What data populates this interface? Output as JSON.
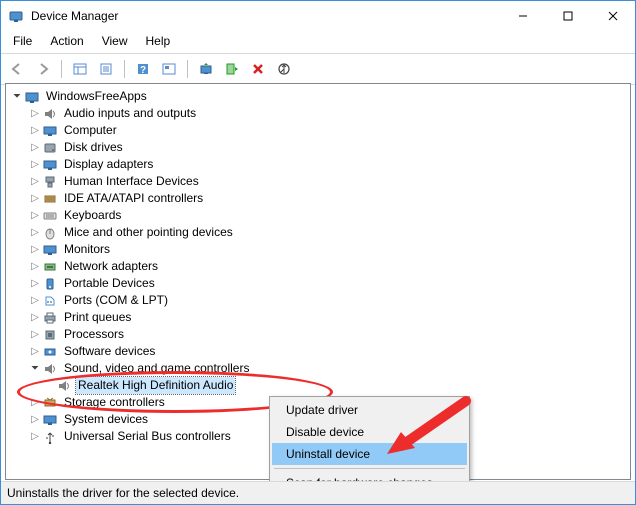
{
  "window": {
    "title": "Device Manager"
  },
  "menus": {
    "file": "File",
    "action": "Action",
    "view": "View",
    "help": "Help"
  },
  "tree": {
    "root": "WindowsFreeApps",
    "cats": {
      "audio": "Audio inputs and outputs",
      "computer": "Computer",
      "disk": "Disk drives",
      "display": "Display adapters",
      "hid": "Human Interface Devices",
      "ide": "IDE ATA/ATAPI controllers",
      "keyboards": "Keyboards",
      "mice": "Mice and other pointing devices",
      "monitors": "Monitors",
      "network": "Network adapters",
      "portable": "Portable Devices",
      "ports": "Ports (COM & LPT)",
      "printq": "Print queues",
      "processors": "Processors",
      "software": "Software devices",
      "sound": "Sound, video and game controllers",
      "storage": "Storage controllers",
      "system": "System devices",
      "usb": "Universal Serial Bus controllers"
    },
    "sound_child": "Realtek High Definition Audio"
  },
  "context": {
    "update": "Update driver",
    "disable": "Disable device",
    "uninstall": "Uninstall device",
    "scan": "Scan for hardware changes"
  },
  "status": "Uninstalls the driver for the selected device.",
  "annotation": {
    "ellipse_target": "Sound, video and game controllers / Realtek High Definition Audio",
    "arrow_target": "Uninstall device",
    "arrow_color": "#ed2c2c"
  }
}
